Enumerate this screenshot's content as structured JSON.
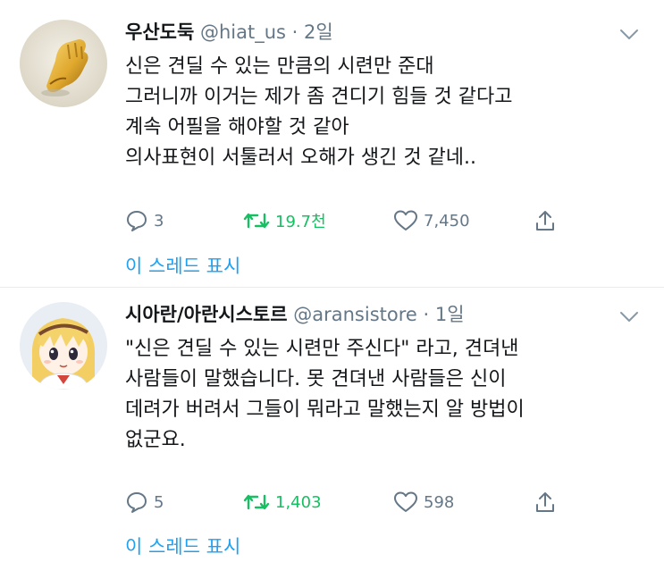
{
  "tweets": [
    {
      "display_name": "우산도둑",
      "handle": "@hiat_us",
      "separator": "·",
      "time": "2일",
      "lines": [
        "신은 견딜 수 있는 만큼의 시련만 준대",
        "그러니까 이거는 제가 좀 견디기 힘들 것 같다고",
        "계속 어필을 해야할 것 같아",
        "의사표현이 서툴러서 오해가 생긴 것 같네.."
      ],
      "reply_count": "3",
      "retweet_count": "19.7천",
      "like_count": "7,450",
      "thread_link": "이 스레드 표시",
      "avatar_icon": "golden-hand-icon"
    },
    {
      "display_name": "시아란/아란시스토르",
      "handle": "@aransistore",
      "separator": "·",
      "time": "1일",
      "lines": [
        "\"신은 견딜 수 있는 시련만 주신다\" 라고, 견뎌낸",
        "사람들이 말했습니다. 못 견뎌낸 사람들은 신이",
        "데려가 버려서 그들이 뭐라고 말했는지 알 방법이",
        "없군요."
      ],
      "reply_count": "5",
      "retweet_count": "1,403",
      "like_count": "598",
      "thread_link": "이 스레드 표시",
      "avatar_icon": "anime-girl-icon"
    }
  ],
  "colors": {
    "text": "#14171a",
    "secondary": "#657786",
    "link": "#1da1f2",
    "retweet": "#17bf63",
    "divider": "#e6ecf0"
  }
}
